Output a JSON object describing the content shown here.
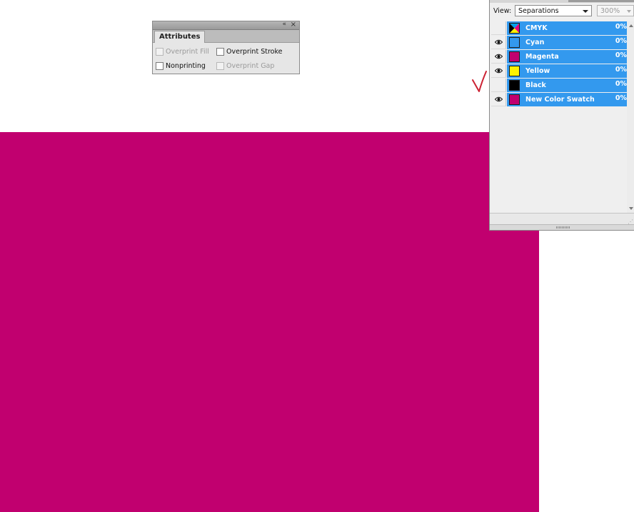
{
  "canvas": {
    "magenta_color": "#c1006f"
  },
  "attributes_panel": {
    "tab_label": "Attributes",
    "overprint_fill": {
      "label": "Overprint Fill",
      "checked": false,
      "enabled": false
    },
    "overprint_stroke": {
      "label": "Overprint Stroke",
      "checked": false,
      "enabled": true
    },
    "nonprinting": {
      "label": "Nonprinting",
      "checked": false,
      "enabled": true
    },
    "overprint_gap": {
      "label": "Overprint Gap",
      "checked": false,
      "enabled": false
    },
    "collapse_icon": "double-left-arrow",
    "close_icon": "close-x"
  },
  "separations_panel": {
    "view_label": "View:",
    "view_value": "Separations",
    "zoom_value": "300%",
    "row_highlight_color": "#3399ee",
    "rows": [
      {
        "name": "CMYK",
        "percent": "0%",
        "visible": false,
        "swatch": "cmyk"
      },
      {
        "name": "Cyan",
        "percent": "0%",
        "visible": true,
        "swatch": "#3399ee"
      },
      {
        "name": "Magenta",
        "percent": "0%",
        "visible": true,
        "swatch": "#c1006f"
      },
      {
        "name": "Yellow",
        "percent": "0%",
        "visible": true,
        "swatch": "#fff200"
      },
      {
        "name": "Black",
        "percent": "0%",
        "visible": false,
        "swatch": "#000000"
      },
      {
        "name": "New Color Swatch",
        "percent": "0%",
        "visible": true,
        "swatch": "#c1006f"
      }
    ]
  },
  "annotation": {
    "check_mark_color": "#cc2233"
  }
}
